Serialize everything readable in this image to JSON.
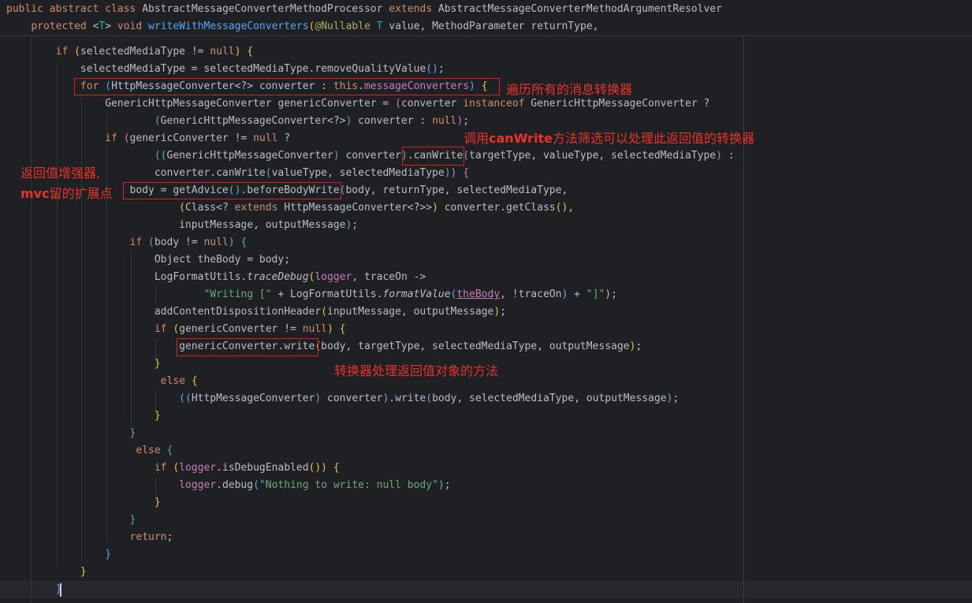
{
  "editor": {
    "header_lines": [
      "public abstract class AbstractMessageConverterMethodProcessor extends AbstractMessageConverterMethodArgumentResolver",
      "    protected <T> void writeWithMessageConverters(@Nullable T value, MethodParameter returnType,"
    ],
    "lines": [
      "        if (selectedMediaType != null) {",
      "            selectedMediaType = selectedMediaType.removeQualityValue();",
      "            for (HttpMessageConverter<?> converter : this.messageConverters) {",
      "                GenericHttpMessageConverter genericConverter = (converter instanceof GenericHttpMessageConverter ?",
      "                        (GenericHttpMessageConverter<?>) converter : null);",
      "                if (genericConverter != null ?",
      "                        ((GenericHttpMessageConverter) converter).canWrite(targetType, valueType, selectedMediaType) :",
      "                        converter.canWrite(valueType, selectedMediaType)) {",
      "                    body = getAdvice().beforeBodyWrite(body, returnType, selectedMediaType,",
      "                            (Class<? extends HttpMessageConverter<?>>) converter.getClass(),",
      "                            inputMessage, outputMessage);",
      "                    if (body != null) {",
      "                        Object theBody = body;",
      "                        LogFormatUtils.traceDebug(logger, traceOn ->",
      "                                \"Writing [\" + LogFormatUtils.formatValue(theBody, !traceOn) + \"]\");",
      "                        addContentDispositionHeader(inputMessage, outputMessage);",
      "                        if (genericConverter != null) {",
      "                            genericConverter.write(body, targetType, selectedMediaType, outputMessage);",
      "                        }",
      "                         else {",
      "                            ((HttpMessageConverter) converter).write(body, selectedMediaType, outputMessage);",
      "                        }",
      "                    }",
      "                     else {",
      "                        if (logger.isDebugEnabled()) {",
      "                            logger.debug(\"Nothing to write: null body\");",
      "                        }",
      "                    }",
      "                    return;",
      "                }",
      "            }",
      "        }"
    ]
  },
  "annotations": {
    "loop_note": "遍历所有的消息转换器",
    "canwrite_note_prefix": "调用",
    "canwrite_note_bold": "canWrite",
    "canwrite_note_suffix": "方法筛选可以处理此返回值的转换器",
    "advice_note_line1": "返回值增强器,",
    "advice_note_bold": "mvc",
    "advice_note_line2_suffix": "留的扩展点",
    "write_note": "转换器处理返回值对象的方法"
  },
  "colors": {
    "background": "#1f2024",
    "annotation_red": "#e8332a",
    "keyword": "#cf8e6d",
    "method": "#56a8f5",
    "field": "#c77dbb",
    "string": "#6aab73"
  }
}
